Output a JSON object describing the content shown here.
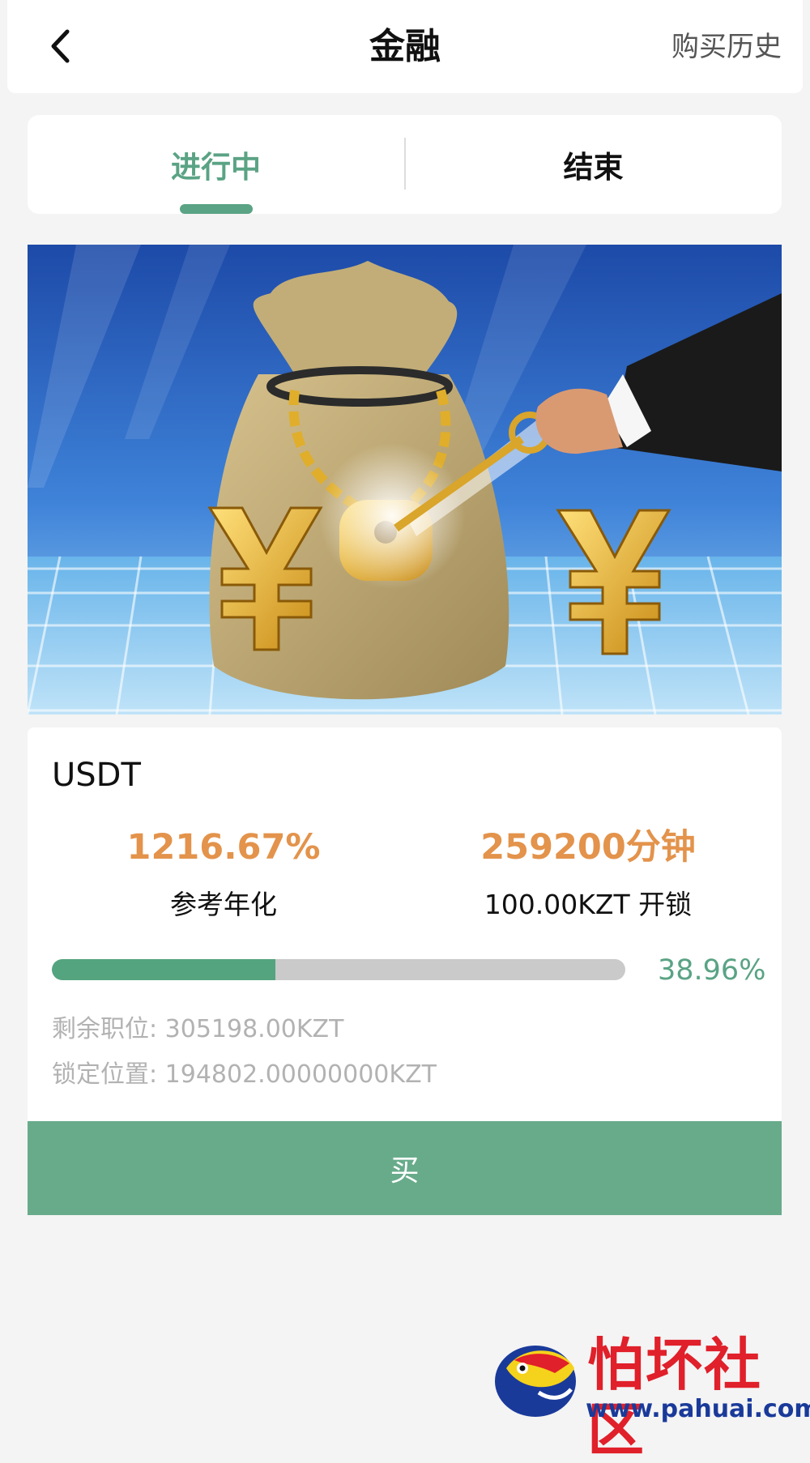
{
  "header": {
    "title": "金融",
    "back_icon": "chevron-left-icon",
    "history_label": "购买历史"
  },
  "tabs": [
    {
      "label": "进行中",
      "active": true
    },
    {
      "label": "结束",
      "active": false
    }
  ],
  "product": {
    "name": "USDT",
    "rate_value": "1216.67%",
    "rate_label": "参考年化",
    "duration_value": "259200分钟",
    "unlock_label": "100.00KZT 开锁",
    "progress_percent": 38.96,
    "progress_text": "38.96%",
    "remaining": "剩余职位: 305198.00KZT",
    "locked": "锁定位置: 194802.00000000KZT"
  },
  "buy_button": {
    "label": "买"
  },
  "watermark": {
    "title": "怕坏社区",
    "url": "www.pahuai.com"
  },
  "colors": {
    "accent_green": "#5aa384",
    "button_green": "#68ab8b",
    "orange": "#e3934b",
    "watermark_red": "#e0202a",
    "watermark_blue": "#1a3a9a"
  }
}
